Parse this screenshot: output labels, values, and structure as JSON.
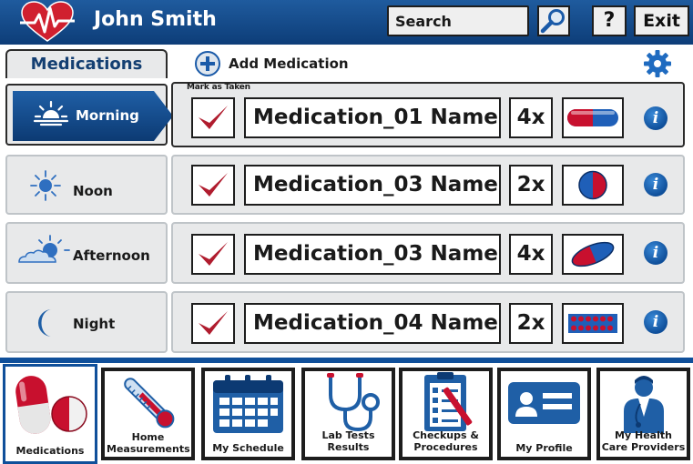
{
  "header": {
    "user_name": "John Smith",
    "search_label": "Search",
    "help_label": "?",
    "exit_label": "Exit"
  },
  "section_tab": "Medications",
  "add_medication_label": "Add Medication",
  "mark_as_taken_label": "Mark as Taken",
  "times": [
    {
      "label": "Morning",
      "icon": "sunrise-icon",
      "selected": true
    },
    {
      "label": "Noon",
      "icon": "sun-icon",
      "selected": false
    },
    {
      "label": "Afternoon",
      "icon": "sun-cloud-icon",
      "selected": false
    },
    {
      "label": "Night",
      "icon": "moon-icon",
      "selected": false
    }
  ],
  "medications": [
    {
      "name": "Medication_01 Name",
      "dose": "4x",
      "pill": "capsule-red-blue-icon",
      "taken": true
    },
    {
      "name": "Medication_03 Name",
      "dose": "2x",
      "pill": "round-tablet-blue-red-icon",
      "taken": true
    },
    {
      "name": "Medication_03 Name",
      "dose": "4x",
      "pill": "oval-tablet-red-blue-icon",
      "taken": true
    },
    {
      "name": "Medication_04 Name",
      "dose": "2x",
      "pill": "blister-pack-icon",
      "taken": true
    }
  ],
  "nav": [
    {
      "label": "Medications",
      "icon": "pills-icon",
      "active": true
    },
    {
      "label": "Home Measurements",
      "icon": "thermometer-icon"
    },
    {
      "label": "My Schedule",
      "icon": "calendar-icon"
    },
    {
      "label": "Lab Tests Results",
      "icon": "stethoscope-icon"
    },
    {
      "label": "Checkups & Procedures",
      "icon": "clipboard-icon"
    },
    {
      "label": "My Profile",
      "icon": "id-card-icon"
    },
    {
      "label": "My Health Care Providers",
      "icon": "doctor-icon"
    }
  ],
  "colors": {
    "brand_blue": "#0f4f9a",
    "header_blue": "#1a5596",
    "check_red": "#b01c2e",
    "panel_gray": "#e8e9ea"
  }
}
